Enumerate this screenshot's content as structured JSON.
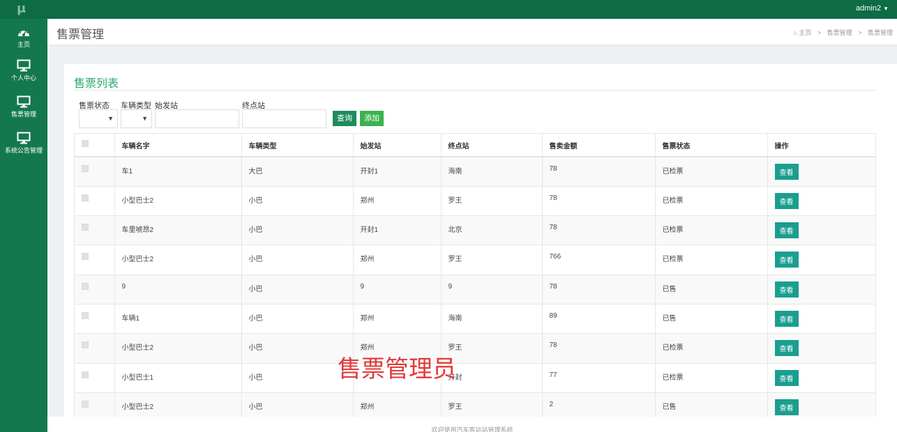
{
  "app": {
    "logo": "μ"
  },
  "topbar": {
    "user": "admin2"
  },
  "sidebar": {
    "items": [
      {
        "label": "主页",
        "icon": "dashboard-icon"
      },
      {
        "label": "个人中心",
        "icon": "monitor-icon"
      },
      {
        "label": "售票管理",
        "icon": "monitor-icon"
      },
      {
        "label": "系统公告管理",
        "icon": "monitor-icon"
      }
    ]
  },
  "header": {
    "title": "售票管理",
    "breadcrumb": [
      "主页",
      "售票管理",
      "售票管理"
    ]
  },
  "panel": {
    "title": "售票列表",
    "filters": {
      "status_label": "售票状态",
      "vehicle_type_label": "车辆类型",
      "start_label": "始发站",
      "end_label": "终点站",
      "status_value": "",
      "vehicle_type_value": "",
      "start_value": "",
      "end_value": ""
    },
    "search_label": "查询",
    "add_label": "添加"
  },
  "table": {
    "columns": [
      "",
      "车辆名字",
      "车辆类型",
      "始发站",
      "终点站",
      "售卖金额",
      "售票状态",
      "操作"
    ],
    "view_label": "查看",
    "rows": [
      [
        "车1",
        "大巴",
        "开封1",
        "海南",
        "78",
        "已检票"
      ],
      [
        "小型巴士2",
        "小巴",
        "郑州",
        "罗王",
        "78",
        "已检票"
      ],
      [
        "车里唬昂2",
        "小巴",
        "开封1",
        "北京",
        "78",
        "已检票"
      ],
      [
        "小型巴士2",
        "小巴",
        "郑州",
        "罗王",
        "766",
        "已检票"
      ],
      [
        "9",
        "小巴",
        "9",
        "9",
        "78",
        "已售"
      ],
      [
        "车辆1",
        "小巴",
        "郑州",
        "海南",
        "89",
        "已售"
      ],
      [
        "小型巴士2",
        "小巴",
        "郑州",
        "罗王",
        "78",
        "已检票"
      ],
      [
        "小型巴士1",
        "小巴",
        "",
        "开封",
        "77",
        "已检票"
      ],
      [
        "小型巴士2",
        "小巴",
        "郑州",
        "罗王",
        "2",
        "已售"
      ]
    ]
  },
  "watermark": "售票管理员",
  "footer": "欢迎使用汽车客运站管理系统"
}
